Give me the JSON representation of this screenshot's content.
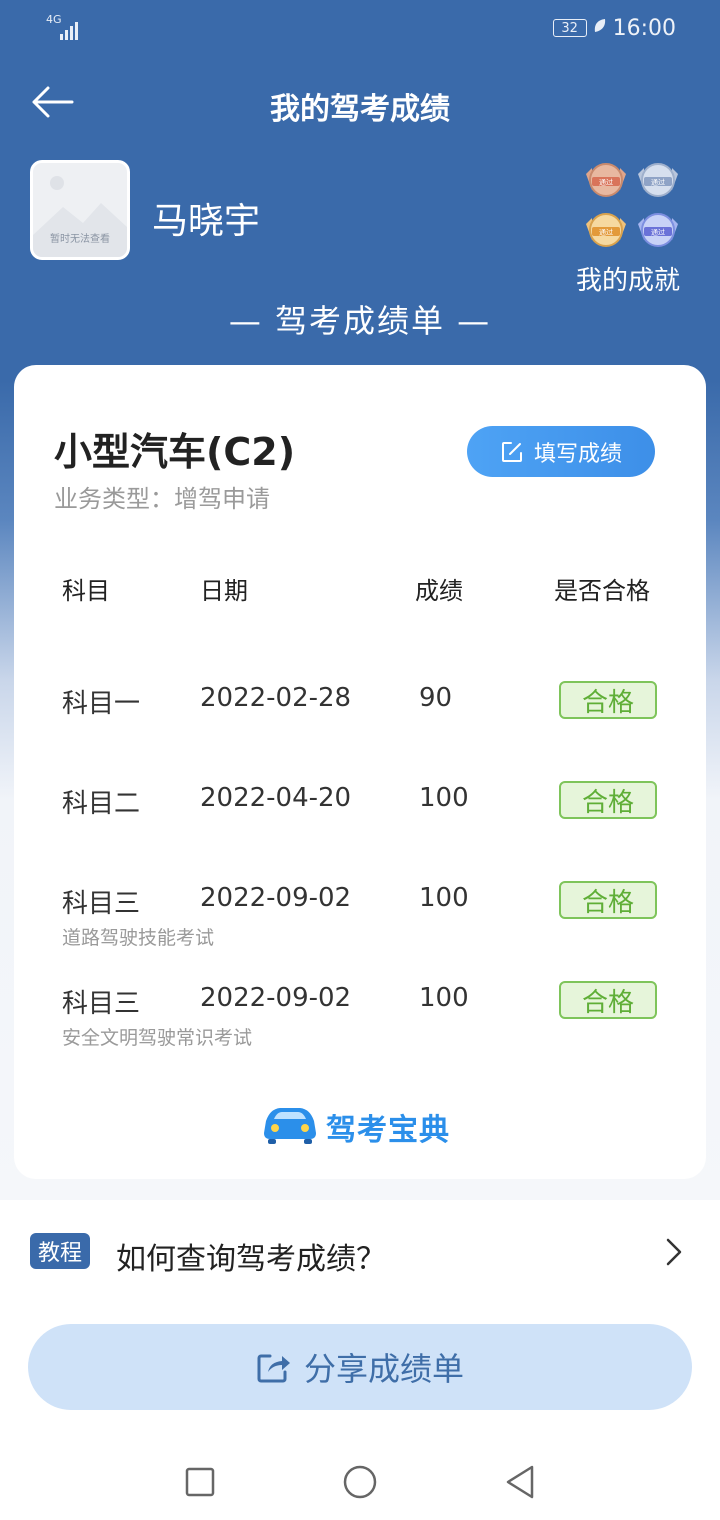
{
  "status_bar": {
    "network": "4G",
    "battery": "32",
    "time": "16:00"
  },
  "header": {
    "title": "我的驾考成绩"
  },
  "profile": {
    "avatar_placeholder": "暂时无法查看",
    "name": "马晓宇",
    "achievements_label": "我的成就",
    "medal_text": "通过"
  },
  "sheet_title": "— 驾考成绩单 —",
  "card": {
    "license_type": "小型汽车(C2)",
    "business_type": "业务类型：增驾申请",
    "fill_button": "填写成绩",
    "columns": [
      "科目",
      "日期",
      "成绩",
      "是否合格"
    ],
    "rows": [
      {
        "subject": "科目一",
        "date": "2022-02-28",
        "score": "90",
        "status": "合格",
        "note": ""
      },
      {
        "subject": "科目二",
        "date": "2022-04-20",
        "score": "100",
        "status": "合格",
        "note": ""
      },
      {
        "subject": "科目三",
        "date": "2022-09-02",
        "score": "100",
        "status": "合格",
        "note": "道路驾驶技能考试"
      },
      {
        "subject": "科目三",
        "date": "2022-09-02",
        "score": "100",
        "status": "合格",
        "note": "安全文明驾驶常识考试"
      }
    ],
    "brand": "驾考宝典"
  },
  "tutorial": {
    "badge": "教程",
    "text": "如何查询驾考成绩？"
  },
  "share_button": "分享成绩单",
  "colors": {
    "header_blue": "#3a6aaa",
    "button_blue": "#3d8fe8",
    "pass_green": "#5fae37",
    "share_bg": "#cfe2f8"
  }
}
